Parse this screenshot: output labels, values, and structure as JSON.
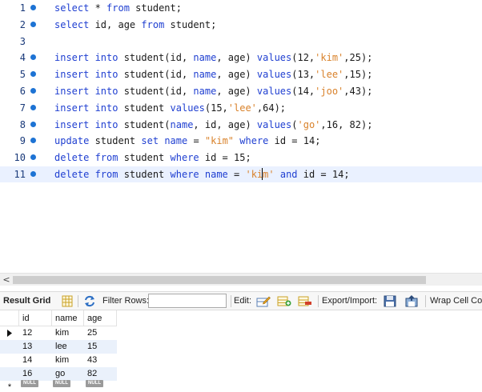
{
  "editor": {
    "lines": [
      {
        "n": "1",
        "html": "<span class=\"kw\">select</span> * <span class=\"kw\">from</span> student;"
      },
      {
        "n": "2",
        "html": "<span class=\"kw\">select</span> id, age <span class=\"kw\">from</span> student;"
      },
      {
        "n": "3",
        "html": ""
      },
      {
        "n": "4",
        "html": "<span class=\"kw\">insert into</span> student(id, <span class=\"kw\">name</span>, age) <span class=\"kw\">values</span>(12,<span class=\"str\">'kim'</span>,25);"
      },
      {
        "n": "5",
        "html": "<span class=\"kw\">insert into</span> student(id, <span class=\"kw\">name</span>, age) <span class=\"kw\">values</span>(13,<span class=\"str\">'lee'</span>,15);"
      },
      {
        "n": "6",
        "html": "<span class=\"kw\">insert into</span> student(id, <span class=\"kw\">name</span>, age) <span class=\"kw\">values</span>(14,<span class=\"str\">'joo'</span>,43);"
      },
      {
        "n": "7",
        "html": "<span class=\"kw\">insert into</span> student <span class=\"kw\">values</span>(15,<span class=\"str\">'lee'</span>,64);"
      },
      {
        "n": "8",
        "html": "<span class=\"kw\">insert into</span> student(<span class=\"kw\">name</span>, id, age) <span class=\"kw\">values</span>(<span class=\"str\">'go'</span>,16, 82);"
      },
      {
        "n": "9",
        "html": "<span class=\"kw\">update</span> student <span class=\"kw\">set</span> <span class=\"kw\">name</span> = <span class=\"str\">\"kim\"</span> <span class=\"kw\">where</span> id = 14;"
      },
      {
        "n": "10",
        "html": "<span class=\"kw\">delete from</span> student <span class=\"kw\">where</span> id = 15;"
      },
      {
        "n": "11",
        "html": "<span class=\"kw\">delete from</span> student <span class=\"kw\">where</span> <span class=\"kw\">name</span> = <span class=\"str\">'ki<span class=\"caret\"></span>m'</span> <span class=\"kw\">and</span> id = 14;"
      }
    ]
  },
  "toolbar": {
    "result_grid": "Result Grid",
    "filter_rows": "Filter Rows:",
    "filter_value": "",
    "edit": "Edit:",
    "export_import": "Export/Import:",
    "wrap": "Wrap Cell Con"
  },
  "grid": {
    "columns": [
      "id",
      "name",
      "age"
    ],
    "rows": [
      [
        "12",
        "kim",
        "25"
      ],
      [
        "13",
        "lee",
        "15"
      ],
      [
        "14",
        "kim",
        "43"
      ],
      [
        "16",
        "go",
        "82"
      ]
    ],
    "null_label": "NULL",
    "new_row_marker": "*"
  },
  "scroll": {
    "left_arrow": "<"
  },
  "colors": {
    "keyword": "#1f3fd1",
    "string": "#d9822b",
    "gutter_dot": "#1d73d4",
    "alt_row": "#eaf1fb"
  }
}
